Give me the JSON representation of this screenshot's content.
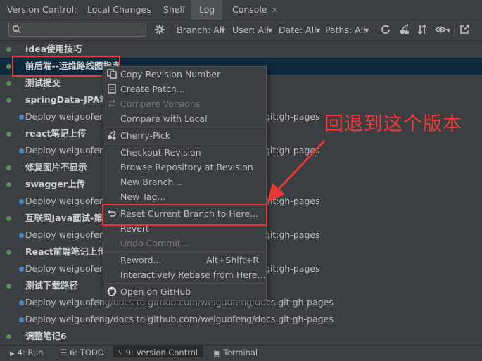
{
  "tabbar": {
    "label": "Version Control:",
    "tabs": [
      {
        "label": "Local Changes"
      },
      {
        "label": "Shelf"
      },
      {
        "label": "Log"
      },
      {
        "label": "Console"
      }
    ]
  },
  "toolbar": {
    "search_value": "",
    "filters": {
      "branch": "Branch: All",
      "user": "User: All",
      "date": "Date: All",
      "paths": "Paths: All"
    }
  },
  "log_rows": [
    {
      "text": "idea使用技巧",
      "ref": ""
    },
    {
      "text": "前后端--运维路线图指南",
      "ref": ""
    },
    {
      "text": "测试提交",
      "ref": ""
    },
    {
      "text": "springData-JPA笔",
      "ref": ""
    },
    {
      "text": "Deploy weiguofeng",
      "ref": ".git:gh-pages"
    },
    {
      "text": "react笔记上传",
      "ref": ""
    },
    {
      "text": "Deploy weiguofeng",
      "ref": ".git:gh-pages"
    },
    {
      "text": "修复图片不显示",
      "ref": ""
    },
    {
      "text": "swagger上传",
      "ref": ""
    },
    {
      "text": "Deploy weiguofeng",
      "ref": ".git:gh-pages"
    },
    {
      "text": "互联网Java面试-第",
      "ref": ""
    },
    {
      "text": "Deploy weiguofeng",
      "ref": ".git:gh-pages"
    },
    {
      "text": "React前端笔记上传第",
      "ref": ""
    },
    {
      "text": "Deploy weiguofeng",
      "ref": ".git:gh-pages"
    },
    {
      "text": "测试下载路径",
      "ref": ""
    },
    {
      "text": "Deploy weiguofeng/docs to github.com/weiguofeng/docs.git:gh-pages",
      "ref": ""
    },
    {
      "text": "Deploy weiguofeng/docs to github.com/weiguofeng/docs.git:gh-pages",
      "ref": ""
    },
    {
      "text": "调整笔记6",
      "ref": ""
    }
  ],
  "context_menu": {
    "copy_revision": "Copy Revision Number",
    "create_patch": "Create Patch...",
    "compare_versions": "Compare Versions",
    "compare_local": "Compare with Local",
    "cherry_pick": "Cherry-Pick",
    "checkout_revision": "Checkout Revision",
    "browse_repo": "Browse Repository at Revision",
    "new_branch": "New Branch...",
    "new_tag": "New Tag...",
    "reset_branch": "Reset Current Branch to Here...",
    "revert": "Revert",
    "undo_commit": "Undo Commit...",
    "reword": "Reword...",
    "reword_shortcut": "Alt+Shift+R",
    "interactive_rebase": "Interactively Rebase from Here...",
    "open_github": "Open on GitHub"
  },
  "annotation": "回退到这个版本",
  "bottom_tabs": {
    "run": "4: Run",
    "todo": "6: TODO",
    "version_control": "9: Version Control",
    "terminal": "Terminal"
  },
  "colors": {
    "background": "#3c3f41",
    "selected_row": "#0d293e",
    "highlight_red": "#e53935",
    "graph_green": "#5a8f5a",
    "graph_blue": "#4a87c8",
    "menu_hover": "#4b6eaf"
  }
}
